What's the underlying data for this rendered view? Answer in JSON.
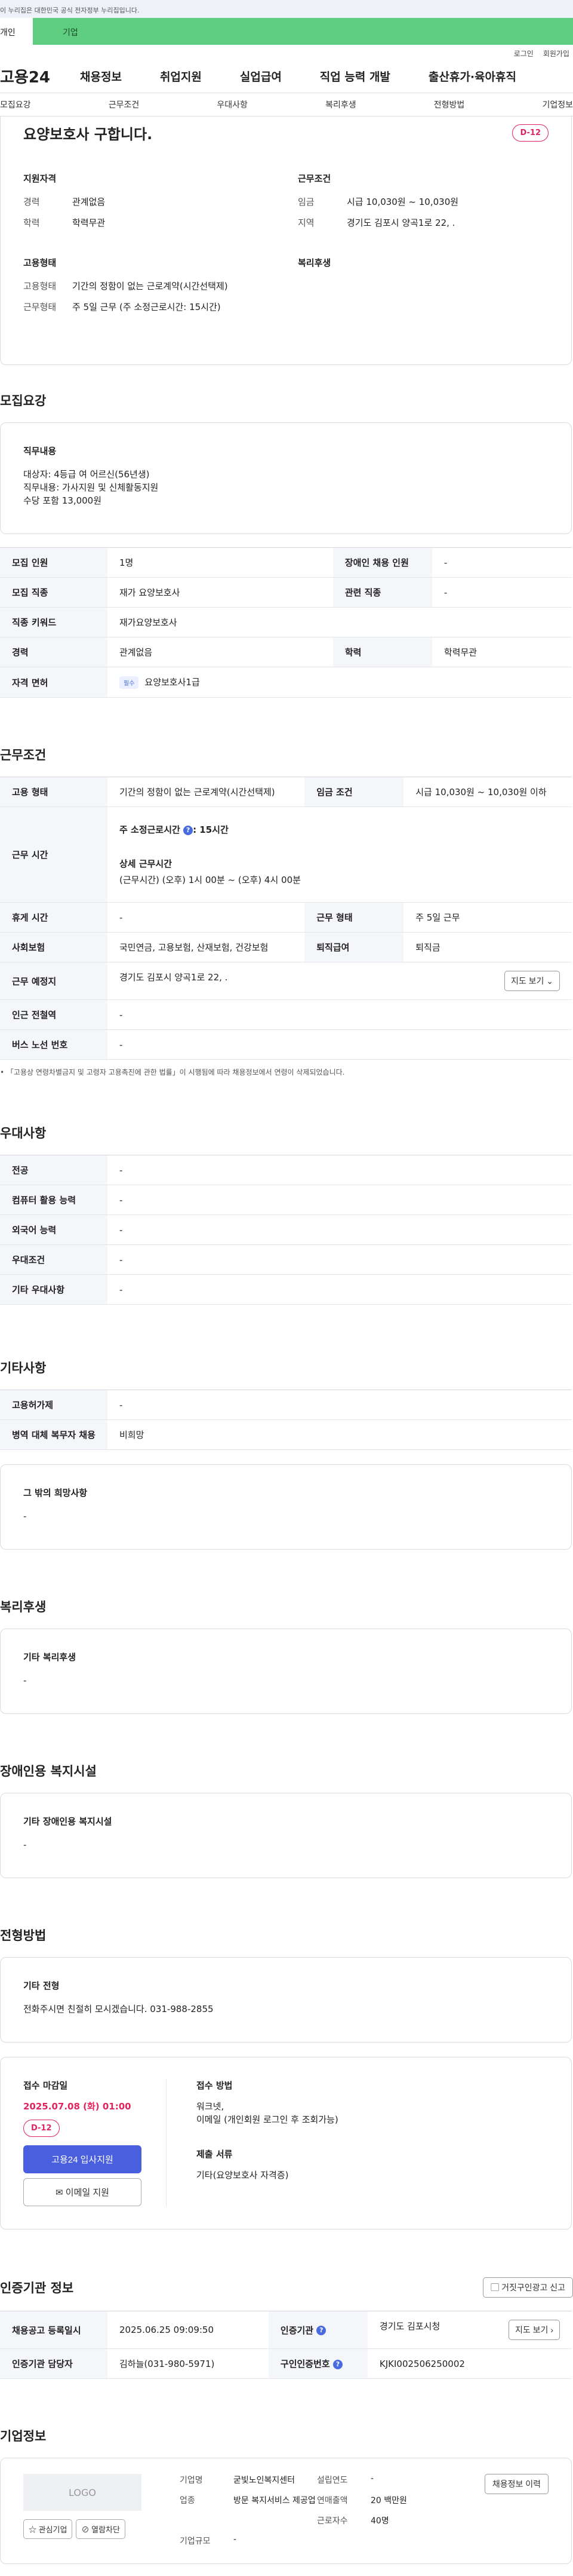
{
  "banner": "이 누리집은 대한민국 공식 전자정부 누리집입니다.",
  "user_tabs": [
    "개인",
    "기업"
  ],
  "util": [
    "로그인",
    "회원가입"
  ],
  "gnb": {
    "logo": "고용24",
    "menus": [
      "채용정보",
      "취업지원",
      "실업급여",
      "직업 능력 개발",
      "출산휴가·육아휴직"
    ]
  },
  "subnav": [
    "모집요강",
    "근무조건",
    "우대사항",
    "복리후생",
    "전형방법",
    "기업정보"
  ],
  "job": {
    "title": "요양보호사 구합니다.",
    "dday": "D-12"
  },
  "summary": {
    "qual_title": "지원자격",
    "career_k": "경력",
    "career_v": "관계없음",
    "edu_k": "학력",
    "edu_v": "학력무관",
    "cond_title": "근무조건",
    "wage_k": "임금",
    "wage_v": "시급 10,030원 ~ 10,030원",
    "region_k": "지역",
    "region_v": "경기도 김포시 양곡1로 22, .",
    "emp_title": "고용형태",
    "emp_k": "고용형태",
    "emp_v": "기간의 정함이 없는 근로계약(시간선택제)",
    "work_k": "근무형태",
    "work_v": "주 5일 근무 (주 소정근로시간: 15시간)",
    "welfare_title": "복리후생"
  },
  "recruit": {
    "title": "모집요강",
    "duty_title": "직무내용",
    "duty_lines": [
      "대상자: 4등급 여 어르신(56년생)",
      "직무내용: 가사지원 및 신체활동지원",
      "수당 포함 13,000원"
    ],
    "rows": {
      "count_k": "모집 인원",
      "count_v": "1명",
      "disabled_k": "장애인 채용 인원",
      "disabled_v": "-",
      "job_k": "모집 직종",
      "job_v": "재가 요양보호사",
      "related_k": "관련 직종",
      "related_v": "-",
      "keyword_k": "직종 키워드",
      "keyword_v": "재가요양보호사",
      "career_k": "경력",
      "career_v": "관계없음",
      "edu_k": "학력",
      "edu_v": "학력무관",
      "license_k": "자격 면허",
      "license_badge": "필수",
      "license_v": "요양보호사1급"
    }
  },
  "workcond": {
    "title": "근무조건",
    "emp_k": "고용 형태",
    "emp_v": "기간의 정함이 없는 근로계약(시간선택제)",
    "wage_k": "임금 조건",
    "wage_v": "시급 10,030원 ~ 10,030원 이하",
    "hours_k": "근무 시간",
    "hours_weekly": "주 소정근로시간",
    "hours_weekly_v": ": 15시간",
    "hours_detail_title": "상세 근무시간",
    "hours_detail_v": "(근무시간) (오후) 1시 00분 ~ (오후) 4시 00분",
    "rest_k": "휴게 시간",
    "rest_v": "-",
    "worktype_k": "근무 형태",
    "worktype_v": "주 5일 근무",
    "insurance_k": "사회보험",
    "insurance_v": "국민연금, 고용보험, 산재보험, 건강보험",
    "severance_k": "퇴직급여",
    "severance_v": "퇴직금",
    "place_k": "근무 예정지",
    "place_v": "경기도 김포시 양곡1로 22, .",
    "map_label": "지도 보기",
    "station_k": "인근 전철역",
    "station_v": "-",
    "bus_k": "버스 노선 번호",
    "bus_v": "-",
    "note": "「고용상 연령차별금지 및 고령자 고용촉진에 관한 법률」이 시행됨에 따라 채용정보에서 연령이 삭제되었습니다."
  },
  "pref": {
    "title": "우대사항",
    "rows": [
      {
        "k": "전공",
        "v": "-"
      },
      {
        "k": "컴퓨터 활용 능력",
        "v": "-"
      },
      {
        "k": "외국어 능력",
        "v": "-"
      },
      {
        "k": "우대조건",
        "v": "-"
      },
      {
        "k": "기타 우대사항",
        "v": "-"
      }
    ]
  },
  "etc": {
    "title": "기타사항",
    "rows": [
      {
        "k": "고용허가제",
        "v": "-"
      },
      {
        "k": "병역 대체 복무자 채용",
        "v": "비희망"
      }
    ],
    "box_title": "그 밖의 희망사항",
    "box_v": "-"
  },
  "welfare": {
    "title": "복리후생",
    "box_title": "기타 복리후생",
    "box_v": "-"
  },
  "disabled": {
    "title": "장애인용 복지시설",
    "box_title": "기타 장애인용 복지시설",
    "box_v": "-"
  },
  "selection": {
    "title": "전형방법",
    "box_title": "기타 전형",
    "box_v": "전화주시면 친절히 모시겠습니다. 031-988-2855",
    "deadline_title": "접수 마감일",
    "deadline": "2025.07.08 (화) 01:00",
    "dday": "D-12",
    "apply_btn": "고용24 입사지원",
    "email_btn": "이메일 지원",
    "method_title": "접수 방법",
    "method_v1": "워크넷,",
    "method_v2": "이메일 (개인회원 로그인 후 조회가능)",
    "docs_title": "제출 서류",
    "docs_v": "기타(요양보호사 자격증)"
  },
  "agency": {
    "title": "인증기관 정보",
    "report_btn": "거짓구인광고 신고",
    "reg_k": "채용공고 등록일시",
    "reg_v": "2025.06.25 09:09:50",
    "org_k": "인증기관",
    "org_v": "경기도 김포시청",
    "map_label": "지도 보기",
    "manager_k": "인증기관 담당자",
    "manager_v": "김하늘(031-980-5971)",
    "no_k": "구인인증번호",
    "no_v": "KJKI002506250002"
  },
  "company": {
    "title": "기업정보",
    "logo": "LOGO",
    "fav_btn": "관심기업",
    "block_btn": "열람차단",
    "name_k": "기업명",
    "name_v": "굳빛노인복지센터",
    "founded_k": "설립연도",
    "founded_v": "-",
    "biz_k": "업종",
    "biz_v": "방문 복지서비스 제공업",
    "sales_k": "연매출액",
    "sales_v": "20 백만원",
    "workers_k": "근로자수",
    "workers_v": "40명",
    "size_k": "기업규모",
    "size_v": "-",
    "history_btn": "채용정보 이력"
  }
}
